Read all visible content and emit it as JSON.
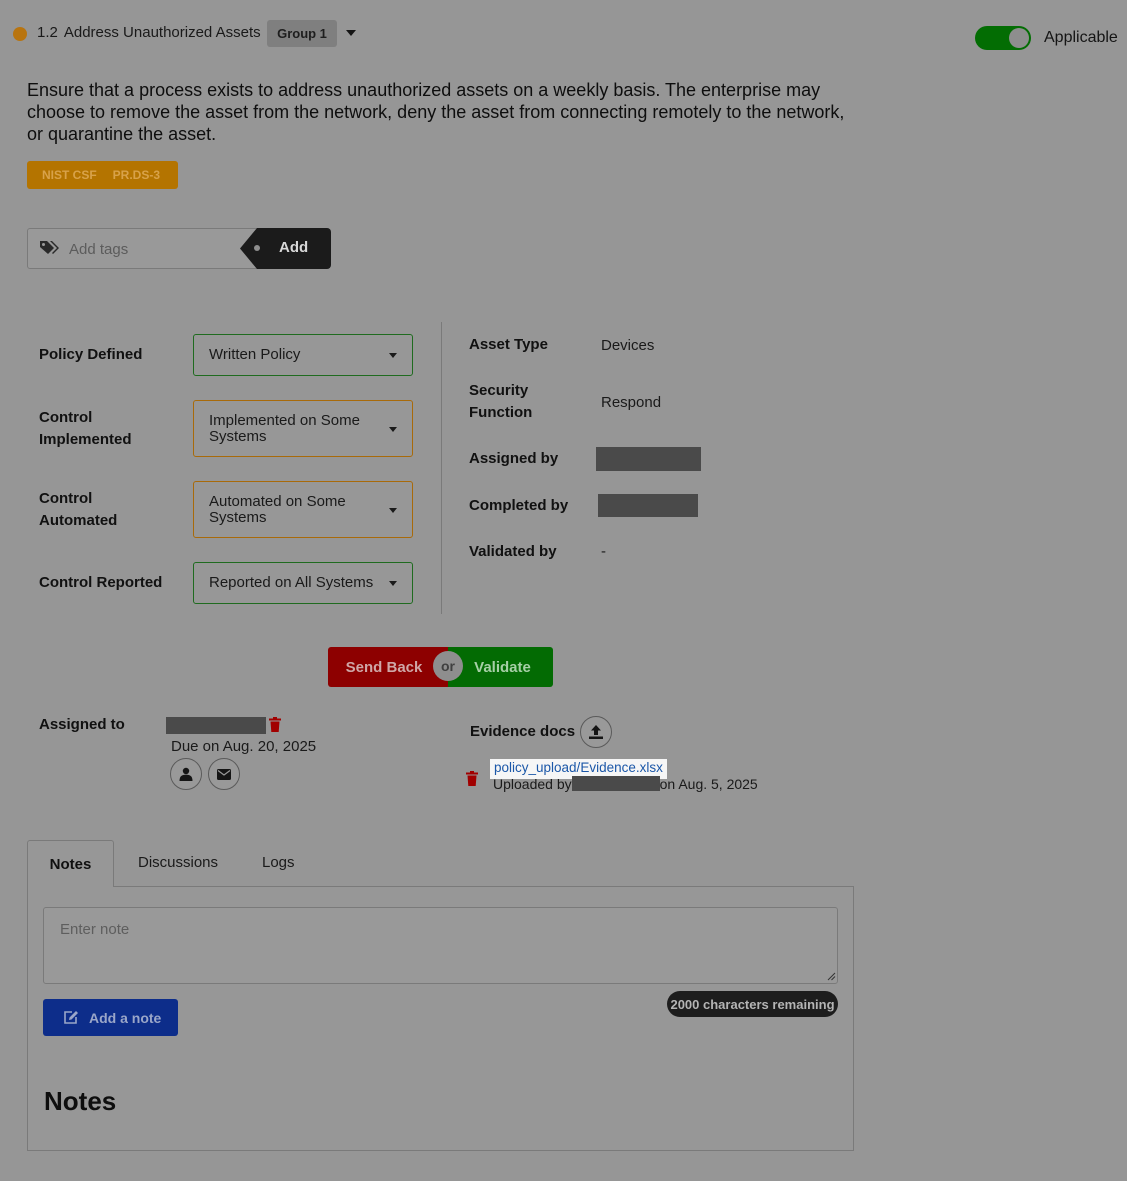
{
  "control": {
    "number": "1.2",
    "title": "Address Unauthorized Assets",
    "group": "Group 1",
    "applicable_label": "Applicable",
    "applicable": true,
    "description": "Ensure that a process exists to address unauthorized assets on a weekly basis. The enterprise may choose to remove the asset from the network, deny the asset from connecting remotely to the network, or quarantine the asset.",
    "framework": "NIST CSF",
    "framework_ref": "PR.DS-3",
    "status_color": "#b8740f"
  },
  "tags": {
    "placeholder": "Add tags",
    "add_label": "Add"
  },
  "form": {
    "policy_defined": {
      "label": "Policy Defined",
      "value": "Written Policy"
    },
    "control_implemented": {
      "label": "Control Implemented",
      "value": "Implemented on Some Systems"
    },
    "control_automated": {
      "label": "Control Automated",
      "value": "Automated on Some Systems"
    },
    "control_reported": {
      "label": "Control Reported",
      "value": "Reported on All Systems"
    }
  },
  "details": {
    "asset_type": {
      "label": "Asset Type",
      "value": "Devices"
    },
    "security_function": {
      "label": "Security Function",
      "value": "Respond"
    },
    "assigned_by": {
      "label": "Assigned by"
    },
    "completed_by": {
      "label": "Completed by"
    },
    "validated_by": {
      "label": "Validated by",
      "value": "-"
    }
  },
  "actions": {
    "send_back": "Send Back",
    "or": "or",
    "validate": "Validate"
  },
  "assignment": {
    "label": "Assigned to",
    "due": "Due on Aug. 20, 2025"
  },
  "evidence": {
    "label": "Evidence docs",
    "file": "policy_upload/Evidence.xlsx",
    "uploaded_prefix": "Uploaded by",
    "uploaded_suffix": "on Aug. 5, 2025"
  },
  "tabs": {
    "items": [
      "Notes",
      "Discussions",
      "Logs"
    ],
    "active": "Notes"
  },
  "notes": {
    "placeholder": "Enter note",
    "add_label": "Add a note",
    "chars_remaining": "2000 characters remaining",
    "heading": "Notes"
  },
  "icons": {
    "tag": "tags-icon",
    "upload": "upload-icon",
    "trash": "trash-icon",
    "user": "user-icon",
    "mail": "envelope-icon",
    "edit": "edit-icon"
  },
  "colors": {
    "send_back": "#8d0000",
    "validate": "#036b03",
    "add_note": "#0d2d8a",
    "framework_badge": "#b47400"
  }
}
